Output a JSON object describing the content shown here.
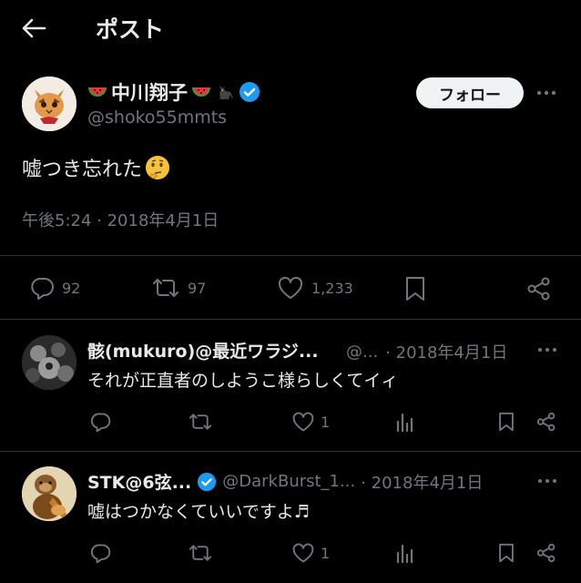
{
  "header": {
    "title": "ポスト"
  },
  "main_post": {
    "display_name": "中川翔子",
    "handle": "@shoko55mmts",
    "follow_label": "フォロー",
    "text": "嘘つき忘れた",
    "timestamp": "午後5:24 · 2018年4月1日",
    "stats": {
      "replies": "92",
      "reposts": "97",
      "likes": "1,233"
    }
  },
  "replies": [
    {
      "display_name": "骸(mukuro)@最近ワラジ...",
      "handle": "@...",
      "date": "· 2018年4月1日",
      "text": "それが正直者のしようこ様らしくてイィ",
      "likes": "1"
    },
    {
      "display_name": "STK@6弦...",
      "handle": "@DarkBurst_1...",
      "date": "· 2018年4月1日",
      "text": "嘘はつかなくていいですよ♬",
      "likes": "1"
    }
  ],
  "colors": {
    "background": "#000000",
    "text": "#e7e9ea",
    "muted": "#71767b",
    "verified": "#1d9bf0",
    "divider": "#2f3336"
  }
}
